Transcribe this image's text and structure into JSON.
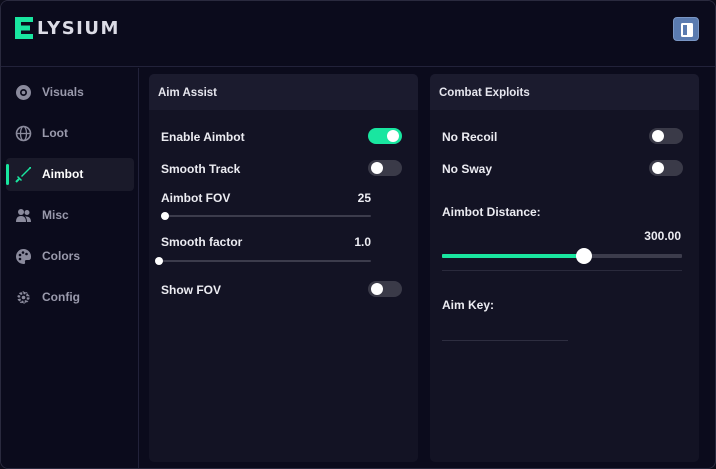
{
  "brand": {
    "logo_letter": "E",
    "name": "LYSIUM"
  },
  "header": {
    "book_icon": "book-icon"
  },
  "sidebar": {
    "items": [
      {
        "label": "Visuals",
        "icon": "eye-icon"
      },
      {
        "label": "Loot",
        "icon": "globe-icon"
      },
      {
        "label": "Aimbot",
        "icon": "sword-icon",
        "active": true
      },
      {
        "label": "Misc",
        "icon": "users-icon"
      },
      {
        "label": "Colors",
        "icon": "palette-icon"
      },
      {
        "label": "Config",
        "icon": "gear-icon"
      }
    ]
  },
  "aim_assist": {
    "title": "Aim Assist",
    "enable_aimbot": {
      "label": "Enable Aimbot",
      "on": true
    },
    "smooth_track": {
      "label": "Smooth Track",
      "on": false
    },
    "aimbot_fov": {
      "label": "Aimbot FOV",
      "value": "25",
      "fraction": 0.02
    },
    "smooth_factor": {
      "label": "Smooth factor",
      "value": "1.0",
      "fraction": 0.0
    },
    "show_fov": {
      "label": "Show FOV",
      "on": false
    }
  },
  "combat_exploits": {
    "title": "Combat Exploits",
    "no_recoil": {
      "label": "No Recoil",
      "on": false
    },
    "no_sway": {
      "label": "No Sway",
      "on": false
    },
    "aimbot_distance": {
      "label": "Aimbot Distance:",
      "value": "300.00",
      "fraction": 0.59
    },
    "aim_key": {
      "label": "Aim Key:",
      "value": ""
    }
  },
  "colors": {
    "accent": "#19e6a0",
    "background": "#0b0b1c",
    "panel": "#131324"
  }
}
